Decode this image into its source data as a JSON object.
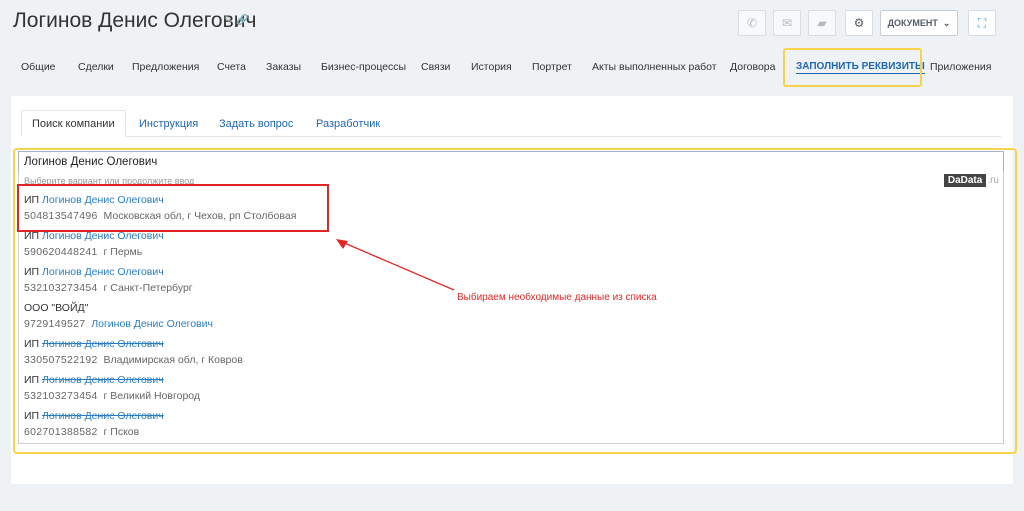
{
  "header": {
    "title": "Логинов Денис Олегович",
    "document_button": "ДОКУМЕНТ"
  },
  "nav": {
    "items": [
      "Общие",
      "Сделки",
      "Предложения",
      "Счета",
      "Заказы",
      "Бизнес-процессы",
      "Связи",
      "История",
      "Портрет",
      "Акты выполненных работ",
      "Договора",
      "ЗАПОЛНИТЬ РЕКВИЗИТЫ",
      "Приложения"
    ],
    "active": "ЗАПОЛНИТЬ РЕКВИЗИТЫ"
  },
  "subtabs": [
    "Поиск компании",
    "Инструкция",
    "Задать вопрос",
    "Разработчик"
  ],
  "search": {
    "value": "Логинов Денис Олегович",
    "hint": "Выберите вариант или продолжите ввод",
    "provider_logo": "DaData",
    "provider_suffix": ".ru"
  },
  "suggestions": [
    {
      "prefix": "ИП",
      "name": "Логинов Денис Олегович",
      "inn": "504813547496",
      "address": "Московская обл, г Чехов, рп Столбовая",
      "strike": false
    },
    {
      "prefix": "ИП",
      "name": "Логинов Денис Олегович",
      "inn": "590620448241",
      "address": "г Пермь",
      "strike": false
    },
    {
      "prefix": "ИП",
      "name": "Логинов Денис Олегович",
      "inn": "532103273454",
      "address": "г Санкт-Петербург",
      "strike": false
    },
    {
      "prefix": "ООО \"ВОЙД\"",
      "name": "",
      "inn": "9729149527",
      "address": "Логинов Денис Олегович",
      "strike": false
    },
    {
      "prefix": "ИП",
      "name": "Логинов Денис Олегович",
      "inn": "330507522192",
      "address": "Владимирская обл, г Ковров",
      "strike": true
    },
    {
      "prefix": "ИП",
      "name": "Логинов Денис Олегович",
      "inn": "532103273454",
      "address": "г Великий Новгород",
      "strike": true
    },
    {
      "prefix": "ИП",
      "name": "Логинов Денис Олегович",
      "inn": "602701388582",
      "address": "г Псков",
      "strike": true
    }
  ],
  "annotation": "Выбираем необходимые данные из списка",
  "colors": {
    "highlight": "#f7d34c",
    "callout": "#e02727",
    "link": "#2a7cc4"
  }
}
